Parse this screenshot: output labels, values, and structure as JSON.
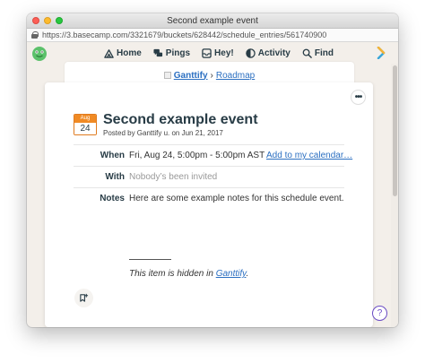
{
  "window": {
    "title": "Second example event"
  },
  "browser": {
    "url": "https://3.basecamp.com/3321679/buckets/628442/schedule_entries/561740900"
  },
  "nav": {
    "home": "Home",
    "pings": "Pings",
    "hey": "Hey!",
    "activity": "Activity",
    "find": "Find"
  },
  "breadcrumb": {
    "project": "Ganttify",
    "separator": "›",
    "section": "Roadmap"
  },
  "event": {
    "title": "Second example event",
    "posted_by": "Posted by Ganttify u. on Jun 21, 2017",
    "date_month": "Aug",
    "date_day": "24",
    "when_label": "When",
    "when_value": "Fri, Aug 24, 5:00pm - 5:00pm AST",
    "add_to_calendar": "Add to my calendar…",
    "with_label": "With",
    "with_value": "Nobody’s been invited",
    "notes_label": "Notes",
    "notes_value": "Here are some example notes for this schedule event.",
    "hidden_prefix": "This item is hidden in ",
    "hidden_project": "Ganttify",
    "hidden_suffix": "."
  },
  "actions": {
    "more": "•••",
    "help": "?"
  },
  "colors": {
    "accent_orange": "#f08a24",
    "link_blue": "#2b6fc1",
    "text_dark": "#283c46",
    "help_purple": "#6a4bc4"
  }
}
